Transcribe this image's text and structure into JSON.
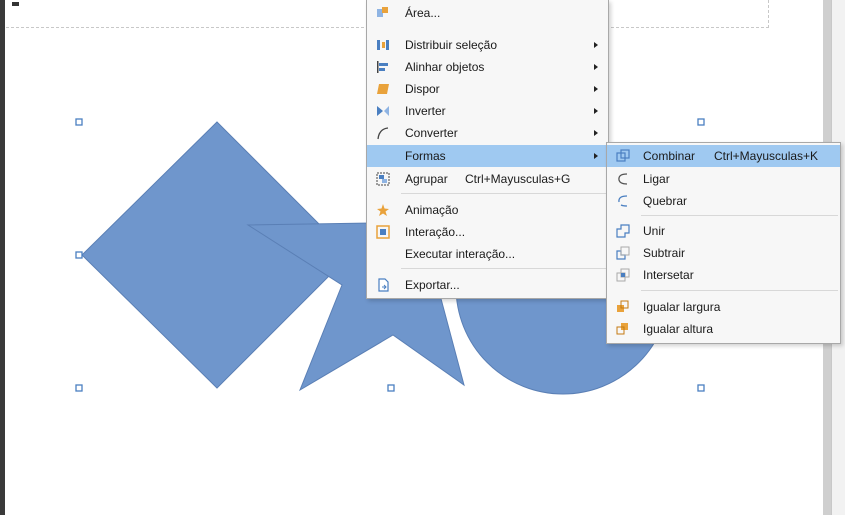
{
  "colors": {
    "shape_fill": "#6f96cc",
    "shape_stroke": "#5a7fb5",
    "menu_highlight": "#9fc9f1",
    "handle": "#4a7fc1"
  },
  "canvas": {
    "shapes": [
      "diamond",
      "star",
      "circle"
    ]
  },
  "context_menu": {
    "items": [
      {
        "label": "Área...",
        "icon": "area-icon",
        "has_submenu": false
      },
      {
        "label": "Distribuir seleção",
        "icon": "distribute-icon",
        "has_submenu": true
      },
      {
        "label": "Alinhar objetos",
        "icon": "align-icon",
        "has_submenu": true
      },
      {
        "label": "Dispor",
        "icon": "arrange-icon",
        "has_submenu": true
      },
      {
        "label": "Inverter",
        "icon": "flip-icon",
        "has_submenu": true
      },
      {
        "label": "Converter",
        "icon": "convert-icon",
        "has_submenu": true
      },
      {
        "label": "Formas",
        "icon": "",
        "has_submenu": true,
        "highlighted": true
      },
      {
        "label": "Agrupar",
        "shortcut": "Ctrl+Mayusculas+G",
        "icon": "group-icon",
        "has_submenu": false
      },
      {
        "label": "Animação",
        "icon": "animation-icon",
        "has_submenu": false
      },
      {
        "label": "Interação...",
        "icon": "interaction-icon",
        "has_submenu": false
      },
      {
        "label": "Executar interação...",
        "icon": "",
        "has_submenu": false
      },
      {
        "label": "Exportar...",
        "icon": "export-icon",
        "has_submenu": false
      }
    ]
  },
  "shapes_submenu": {
    "items": [
      {
        "label": "Combinar",
        "shortcut": "Ctrl+Mayusculas+K",
        "icon": "combine-icon",
        "highlighted": true
      },
      {
        "label": "Ligar",
        "icon": "connect-icon"
      },
      {
        "label": "Quebrar",
        "icon": "break-icon"
      },
      {
        "label": "Unir",
        "icon": "merge-icon"
      },
      {
        "label": "Subtrair",
        "icon": "subtract-icon"
      },
      {
        "label": "Intersetar",
        "icon": "intersect-icon"
      },
      {
        "label": "Igualar largura",
        "icon": "equal-width-icon"
      },
      {
        "label": "Igualar altura",
        "icon": "equal-height-icon"
      }
    ]
  }
}
